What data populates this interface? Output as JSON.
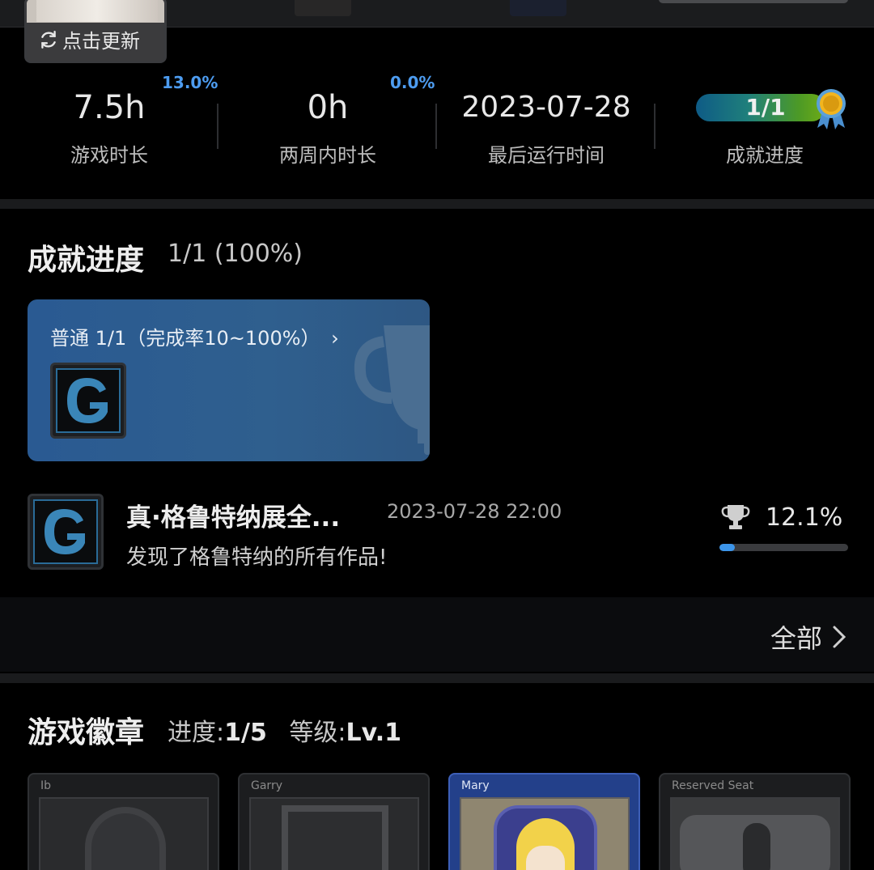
{
  "header": {
    "update_button_label": "点击更新"
  },
  "stats": [
    {
      "value": "7.5h",
      "label": "游戏时长",
      "percent": "13.0%"
    },
    {
      "value": "0h",
      "label": "两周内时长",
      "percent": "0.0%"
    },
    {
      "value": "2023-07-28",
      "label": "最后运行时间"
    },
    {
      "value": "1/1",
      "label": "成就进度",
      "progress_fraction": 1.0
    }
  ],
  "achievements_section": {
    "title": "成就进度",
    "summary": "1/1 (100%)",
    "tier_card": {
      "label": "普通 1/1（完成率10~100%）"
    },
    "item": {
      "name": "真·格鲁特纳展全...",
      "date": "2023-07-28 22:00",
      "description": "发现了格鲁特纳的所有作品!",
      "global_rate": "12.1%",
      "global_rate_fraction": 0.121
    },
    "all_label": "全部"
  },
  "badges_section": {
    "title": "游戏徽章",
    "progress_label": "进度:",
    "progress_value": "1/5",
    "level_label": "等级:",
    "level_value": "Lv.1",
    "badges": [
      {
        "name": "Ib"
      },
      {
        "name": "Garry"
      },
      {
        "name": "Mary"
      },
      {
        "name": "Reserved Seat"
      }
    ]
  },
  "colors": {
    "accent_blue": "#4d9cf0",
    "tier_card": "#2f5f8e",
    "progress_fill": "#3c95ea"
  }
}
